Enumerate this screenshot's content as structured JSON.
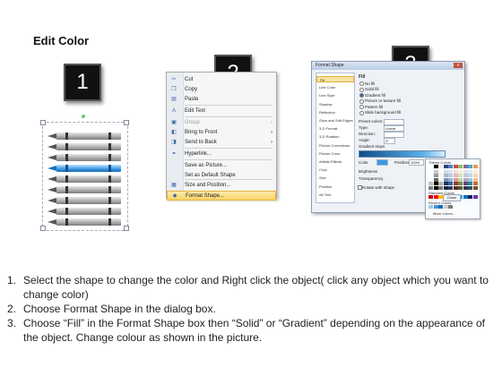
{
  "title": "Edit Color",
  "badges": [
    "1",
    "2",
    "3"
  ],
  "context_menu": {
    "items": [
      {
        "label": "Cut",
        "icon": "scissors-icon",
        "glyph": "✂",
        "disabled": false,
        "submenu": false
      },
      {
        "label": "Copy",
        "icon": "copy-icon",
        "glyph": "❐",
        "disabled": false,
        "submenu": false
      },
      {
        "label": "Paste",
        "icon": "paste-icon",
        "glyph": "▤",
        "disabled": false,
        "submenu": false
      },
      {
        "label": "Edit Text",
        "icon": "edit-text-icon",
        "glyph": "A",
        "disabled": false,
        "submenu": false
      },
      {
        "label": "Group",
        "icon": "group-icon",
        "glyph": "▣",
        "disabled": true,
        "submenu": true
      },
      {
        "label": "Bring to Front",
        "icon": "bring-to-front-icon",
        "glyph": "◧",
        "disabled": false,
        "submenu": true
      },
      {
        "label": "Send to Back",
        "icon": "send-to-back-icon",
        "glyph": "◨",
        "disabled": false,
        "submenu": true
      },
      {
        "label": "Hyperlink...",
        "icon": "hyperlink-icon",
        "glyph": "⚭",
        "disabled": false,
        "submenu": false
      },
      {
        "label": "Save as Picture...",
        "icon": "",
        "glyph": "",
        "disabled": false,
        "submenu": false
      },
      {
        "label": "Set as Default Shape",
        "icon": "",
        "glyph": "",
        "disabled": false,
        "submenu": false
      },
      {
        "label": "Size and Position...",
        "icon": "size-position-icon",
        "glyph": "▦",
        "disabled": false,
        "submenu": false
      },
      {
        "label": "Format Shape...",
        "icon": "format-shape-icon",
        "glyph": "◆",
        "disabled": false,
        "submenu": false,
        "highlighted": true
      }
    ],
    "submenu_arrow": "›"
  },
  "dialog": {
    "title": "Format Shape",
    "close": "x",
    "categories": [
      "Fill",
      "Line Color",
      "Line Style",
      "Shadow",
      "Reflection",
      "Glow and Soft Edges",
      "3-D Format",
      "3-D Rotation",
      "Picture Corrections",
      "Picture Color",
      "Artistic Effects",
      "Crop",
      "Size",
      "Position",
      "Alt Text"
    ],
    "fill_heading": "Fill",
    "fill_options": [
      "No fill",
      "Solid fill",
      "Gradient fill",
      "Picture or texture fill",
      "Pattern fill",
      "Slide background fill"
    ],
    "fields": [
      {
        "label": "Preset colors:",
        "value": ""
      },
      {
        "label": "Type:",
        "value": "Linear"
      },
      {
        "label": "Direction:",
        "value": ""
      },
      {
        "label": "Angle:",
        "value": "0°"
      },
      {
        "label": "Gradient stops",
        "value": ""
      }
    ],
    "color_label": "Color",
    "position_label": "Position:",
    "position_value": "100%",
    "brightness_label": "Brightness",
    "transparency_label": "Transparency",
    "rotate_label": "Rotate with shape",
    "palette": {
      "theme_label": "Theme Colors",
      "standard_label": "Standard Colors",
      "recent_label": "Recent Colors",
      "more_label": "More Colors...",
      "theme_top": [
        "#ffffff",
        "#000000",
        "#eeece1",
        "#1f497d",
        "#4f81bd",
        "#c0504d",
        "#9bbb59",
        "#8064a2",
        "#4bacc6",
        "#f79646"
      ],
      "standard": [
        "#c00000",
        "#ff0000",
        "#ffc000",
        "#ffff00",
        "#92d050",
        "#00b050",
        "#00b0f0",
        "#0070c0",
        "#002060",
        "#7030a0"
      ],
      "recent": [
        "#a6c9e2",
        "#3b97e0",
        "#1a6cb5",
        "#cccccc",
        "#7a7a7a"
      ]
    },
    "buttons": [
      "Close"
    ]
  },
  "instructions": [
    {
      "num": "1.",
      "text": "Select the shape to change the color and Right click the object( click any object which you want to change color)"
    },
    {
      "num": "2.",
      "text": "Choose Format Shape in the dialog box."
    },
    {
      "num": "3.",
      "text": "Choose “Fill” in the Format Shape box then “Solid” or “Gradient” depending on the appearance of the object. Change colour as shown in the picture."
    }
  ]
}
